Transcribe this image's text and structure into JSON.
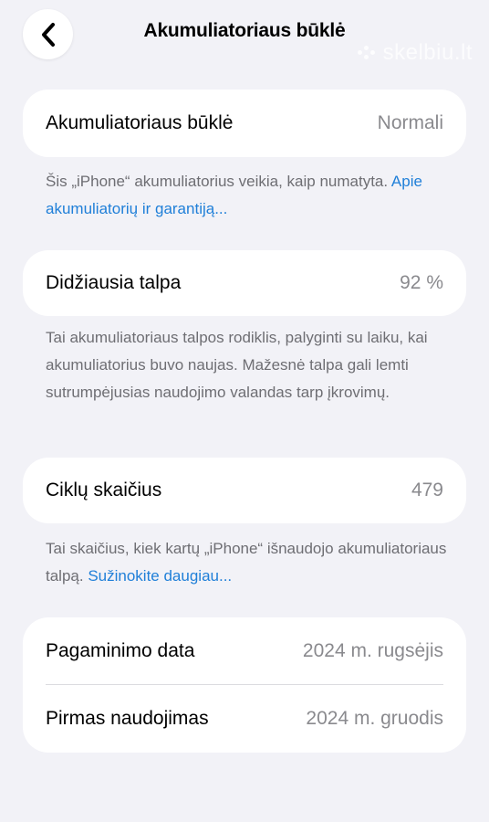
{
  "nav": {
    "title": "Akumuliatoriaus būklė",
    "back_icon": "chevron-left-icon"
  },
  "watermark": {
    "text": "skelbiu.lt"
  },
  "battery_health": {
    "label": "Akumuliatoriaus būklė",
    "value": "Normali",
    "note_text": "Šis „iPhone“ akumuliatorius veikia, kaip numatyta. ",
    "note_link": "Apie akumuliatorių ir garantiją..."
  },
  "max_capacity": {
    "label": "Didžiausia talpa",
    "value": "92 %",
    "note_text": "Tai akumuliatoriaus talpos rodiklis, palyginti su laiku, kai akumuliatorius buvo naujas. Mažesnė talpa gali lemti sutrumpėjusias naudojimo valandas tarp įkrovimų."
  },
  "cycle_count": {
    "label": "Ciklų skaičius",
    "value": "479",
    "note_text": "Tai skaičius, kiek kartų „iPhone“ išnaudojo akumuliatoriaus talpą. ",
    "note_link": "Sužinokite daugiau..."
  },
  "dates": {
    "manufacture_label": "Pagaminimo data",
    "manufacture_value": "2024 m. rugsėjis",
    "first_use_label": "Pirmas naudojimas",
    "first_use_value": "2024 m. gruodis"
  },
  "colors": {
    "background": "#f2f2f7",
    "card": "#ffffff",
    "secondary_text": "#8a8a8e",
    "link": "#1f7fd8"
  }
}
